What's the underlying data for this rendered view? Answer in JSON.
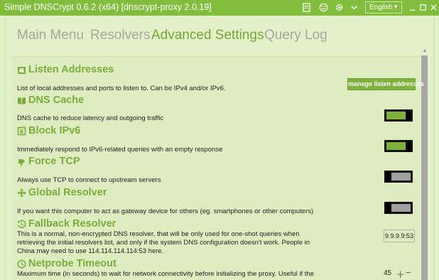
{
  "window": {
    "title": "Simple DNSCrypt 0.6.2 (x64) [dnscrypt-proxy 2.0.19]",
    "language": "English"
  },
  "tabs": [
    {
      "label": "Main Menu",
      "active": false
    },
    {
      "label": "Resolvers",
      "active": false
    },
    {
      "label": "Advanced Settings",
      "active": true
    },
    {
      "label": "Query Log",
      "active": false
    }
  ],
  "sections": {
    "listen": {
      "title": "Listen Addresses",
      "description": "List of local addresses and ports to listen to. Can be IPv4 and/or IPv6.",
      "button_label": "manage listen addresses"
    },
    "cache": {
      "title": "DNS Cache",
      "description": "DNS cache to reduce latency and outgoing traffic",
      "enabled": true
    },
    "ipv6": {
      "title": "Block IPv6",
      "description": "Immediately respond to IPv6-related queries with an empty response",
      "enabled": true
    },
    "tcp": {
      "title": "Force TCP",
      "description": "Always use TCP to connect to upstream servers",
      "enabled": false
    },
    "global": {
      "title": "Global Resolver",
      "description": "If you want this computer to act as gateway device for others (eg. smartphones or other computers)",
      "enabled": false
    },
    "fallback": {
      "title": "Fallback Resolver",
      "description_lines": [
        "This is a normal, non-encrypted DNS resolver, that will be only used for one-shot queries when",
        "retrieving the initial resolvers list, and only if the system DNS configuration doesn't work. People in",
        "China may need to use 114.114.114.114:53 here."
      ],
      "value": "9.9.9.9:53"
    },
    "netprobe": {
      "title": "Netprobe Timeout",
      "description_lines": [
        "Maximum time (in seconds) to wait for network connectivity before initializing the proxy. Useful if the"
      ],
      "value": "45"
    }
  },
  "colors": {
    "titlebar": "#83bd3d",
    "accent": "#7cac3c",
    "background": "#e3f1c8",
    "toggle_on": "#7eb23a",
    "toggle_off": "#a0a0a0"
  },
  "icons": {
    "titlebar": [
      "log-icon",
      "smiley-icon",
      "gear-icon",
      "chevron-down-icon",
      "minimize-icon",
      "maximize-icon",
      "close-icon"
    ],
    "sections": [
      "ethernet-icon",
      "book-icon",
      "ipv6-icon",
      "tcp-icon",
      "move-icon",
      "history-icon",
      "clock-icon"
    ]
  }
}
